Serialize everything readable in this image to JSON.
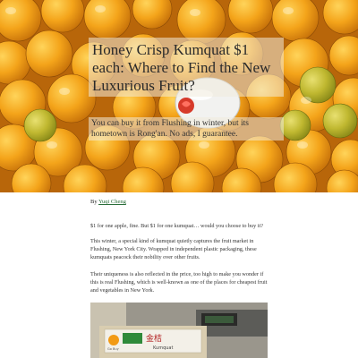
{
  "hero": {
    "title": "Honey Crisp Kumquat $1 each: Where to Find the New Luxurious Fruit?",
    "subtitle": "You can buy it from Flushing in winter, but its hometown is Rong'an. No ads, I guarantee."
  },
  "byline": {
    "prefix": "By ",
    "author": "Yuqi Cheng"
  },
  "paragraphs": [
    "$1 for one apple, fine. But $1 for one kumquat… would you choose to buy it?",
    "This winter, a special kind of kumquat quietly captures the fruit market in Flushing, New York City. Wrapped in independent plastic packaging, these kumquats peacock their nobility over other fruits.",
    "Their uniqueness is also reflected in the price, too high to make you wonder if this is real Flushing, which is well-known as one of the places for cheapest fruit and vegetables in New York."
  ],
  "photo_label": {
    "chinese_brand": "金桔",
    "english_brand": "Kumquat",
    "small_text": "Go Buy"
  }
}
